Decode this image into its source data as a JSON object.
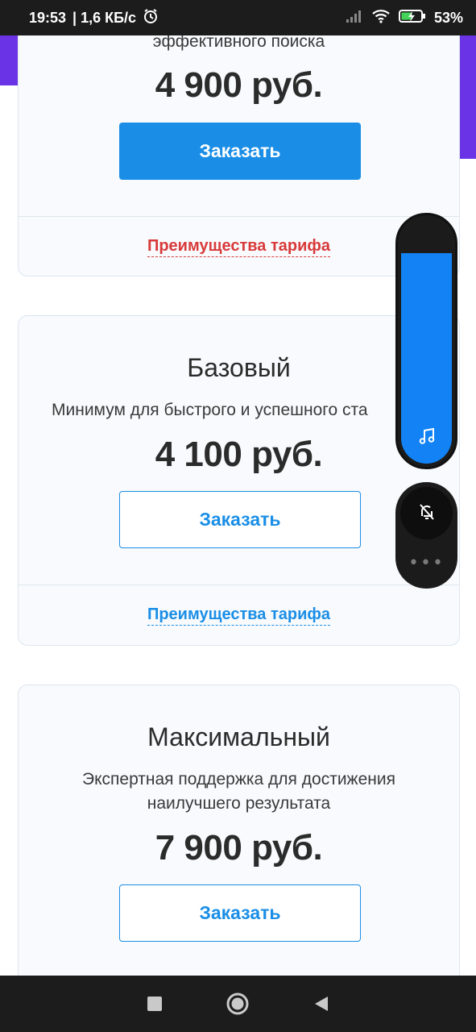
{
  "status_bar": {
    "time": "19:53",
    "speed": "| 1,6 КБ/с",
    "battery": "53%",
    "icons": [
      "alarm-icon",
      "signal-icon",
      "wifi-icon",
      "battery-charging-icon"
    ]
  },
  "cards": {
    "top": {
      "desc_tail": "эффективного поиска",
      "price": "4 900 руб.",
      "order_label": "Заказать",
      "benefits_label": "Преимущества тарифа"
    },
    "base": {
      "title": "Базовый",
      "desc": "Минимум для быстрого и успешного ста",
      "price": "4 100 руб.",
      "order_label": "Заказать",
      "benefits_label": "Преимущества тарифа"
    },
    "max": {
      "title": "Максимальный",
      "desc_line1": "Экспертная поддержка для достижения",
      "desc_line2": "наилучшего результата",
      "price": "7 900 руб.",
      "order_label": "Заказать"
    }
  },
  "volume_panel": {
    "level": 0.86,
    "icon": "music-note-icon"
  },
  "ringer_panel": {
    "icon": "bell-off-icon",
    "more": "•••"
  },
  "nav_bar": {
    "icons": [
      "recents-square-icon",
      "home-circle-icon",
      "back-triangle-icon"
    ]
  },
  "colors": {
    "accent": "#1a8ee6",
    "benefit_red": "#d83a3a",
    "header_purple": "#6a34e6",
    "volume_blue": "#1282f5"
  }
}
